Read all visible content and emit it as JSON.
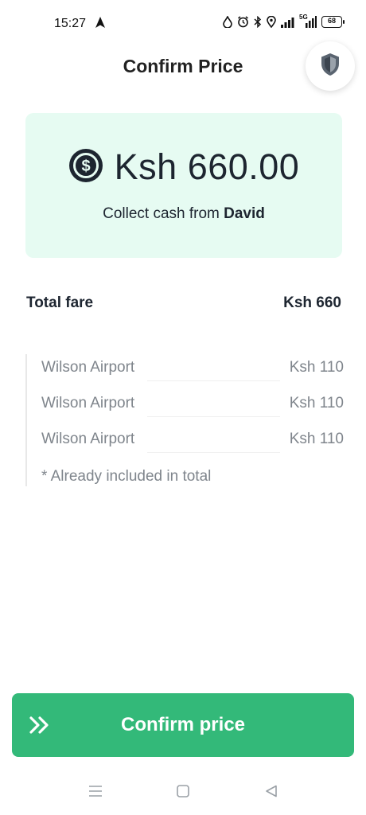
{
  "status_bar": {
    "time": "15:27",
    "network": "5G",
    "battery": "68",
    "icons": [
      "navigation-arrow-icon",
      "water-drop-icon",
      "alarm-icon",
      "bluetooth-icon",
      "location-icon",
      "signal-icon",
      "5g-signal-icon",
      "battery-icon"
    ]
  },
  "header": {
    "title": "Confirm Price",
    "shield_icon": "shield-icon"
  },
  "price_card": {
    "icon": "dollar-coin-icon",
    "amount": "Ksh 660.00",
    "collect_prefix": "Collect cash from ",
    "customer": "David",
    "background": "#e6fbf2"
  },
  "total": {
    "label": "Total fare",
    "value": "Ksh 660"
  },
  "breakdown": {
    "items": [
      {
        "label": "Wilson Airport",
        "value": "Ksh 110"
      },
      {
        "label": "Wilson Airport",
        "value": "Ksh 110"
      },
      {
        "label": "Wilson Airport",
        "value": "Ksh 110"
      }
    ],
    "note": "* Already included in total"
  },
  "confirm_button": {
    "label": "Confirm price",
    "color": "#33b979",
    "icon": "double-chevron-right-icon"
  },
  "nav_bar": {
    "icons": [
      "menu-icon",
      "home-icon",
      "back-icon"
    ]
  }
}
